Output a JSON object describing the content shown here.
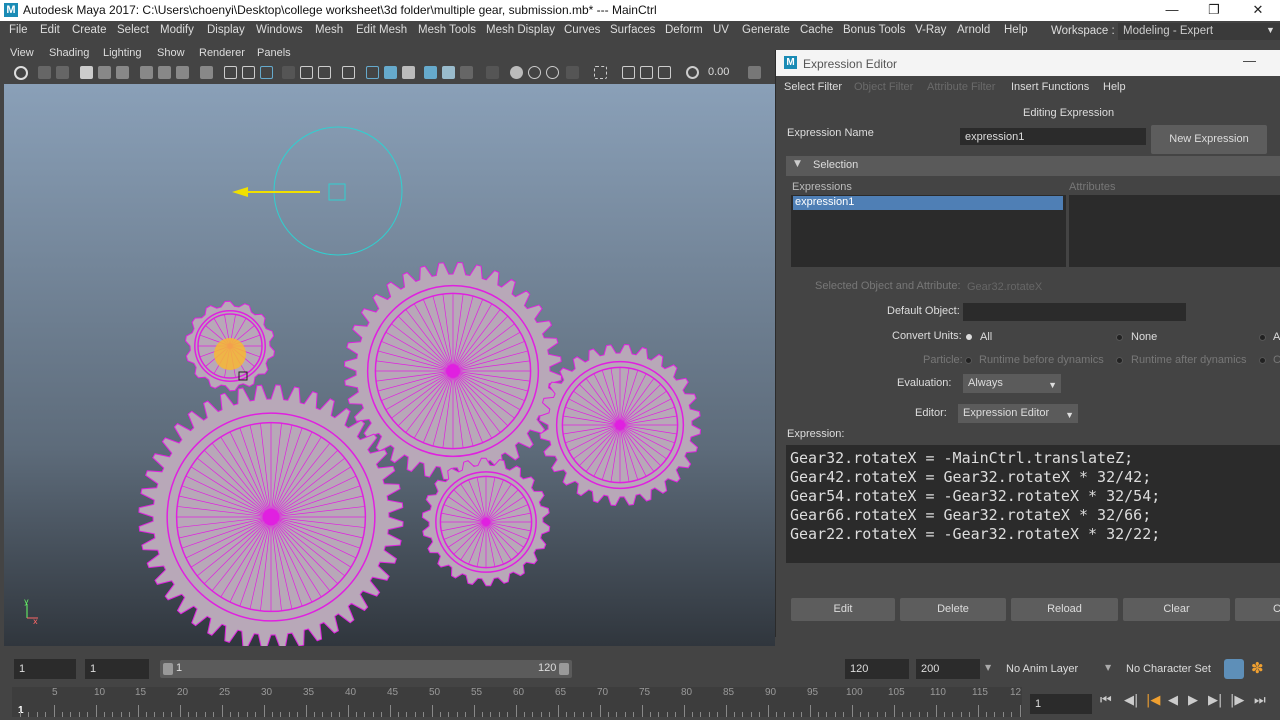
{
  "window": {
    "title": "Autodesk Maya 2017: C:\\Users\\choenyi\\Desktop\\college worksheet\\3d folder\\multiple gear, submission.mb*   ---   MainCtrl",
    "logo_letter": "M"
  },
  "main_menu": [
    "File",
    "Edit",
    "Create",
    "Select",
    "Modify",
    "Display",
    "Windows",
    "Mesh",
    "Edit Mesh",
    "Mesh Tools",
    "Mesh Display",
    "Curves",
    "Surfaces",
    "Deform",
    "UV",
    "Generate",
    "Cache",
    "Bonus Tools",
    "V-Ray",
    "Arnold",
    "Help"
  ],
  "workspace": {
    "label": "Workspace :",
    "value": "Modeling - Expert"
  },
  "viewport_menu": [
    "View",
    "Shading",
    "Lighting",
    "Show",
    "Renderer",
    "Panels"
  ],
  "viewport_toolbar": {
    "value": "0.00"
  },
  "expression_editor": {
    "title": "Expression Editor",
    "menu": [
      {
        "label": "Select Filter",
        "enabled": true
      },
      {
        "label": "Object Filter",
        "enabled": false
      },
      {
        "label": "Attribute Filter",
        "enabled": false
      },
      {
        "label": "Insert Functions",
        "enabled": true
      },
      {
        "label": "Help",
        "enabled": true
      }
    ],
    "editing_label": "Editing Expression",
    "name_label": "Expression Name",
    "name_value": "expression1",
    "new_button": "New Expression",
    "selection_header": "Selection",
    "expressions_header": "Expressions",
    "attributes_header": "Attributes",
    "expressions_list": [
      "expression1"
    ],
    "selected_obj_label": "Selected Object and Attribute:",
    "selected_obj_value": "Gear32.rotateX",
    "default_object_label": "Default Object:",
    "convert_units_label": "Convert Units:",
    "convert_units_options": [
      "All",
      "None",
      "A"
    ],
    "particle_label": "Particle:",
    "particle_options": [
      "Runtime before dynamics",
      "Runtime after dynamics",
      "C"
    ],
    "evaluation_label": "Evaluation:",
    "evaluation_value": "Always",
    "editor_label": "Editor:",
    "editor_value": "Expression Editor",
    "expression_label": "Expression:",
    "code_lines": [
      "Gear32.rotateX = -MainCtrl.translateZ;",
      "Gear42.rotateX = Gear32.rotateX * 32/42;",
      "Gear54.rotateX = -Gear32.rotateX * 32/54;",
      "Gear66.rotateX = Gear32.rotateX * 32/66;",
      "Gear22.rotateX = -Gear32.rotateX * 32/22;"
    ],
    "buttons": [
      "Edit",
      "Delete",
      "Reload",
      "Clear",
      "C"
    ]
  },
  "timeline": {
    "start": "1",
    "current_start": "1",
    "range_start": "1",
    "range_end": "120",
    "end_field": "120",
    "max_field": "200",
    "anim_layer": "No Anim Layer",
    "char_set": "No Character Set",
    "current_frame": "1",
    "ticks": [
      "1",
      "5",
      "10",
      "15",
      "20",
      "25",
      "30",
      "35",
      "40",
      "45",
      "50",
      "55",
      "60",
      "65",
      "70",
      "75",
      "80",
      "85",
      "90",
      "95",
      "100",
      "105",
      "110",
      "115",
      "12"
    ]
  },
  "axis": {
    "y": "y",
    "x": "x"
  },
  "colors": {
    "accent_selection": "#4f7fb5",
    "wire": "#e020e0",
    "manip": "#00d0d0"
  }
}
